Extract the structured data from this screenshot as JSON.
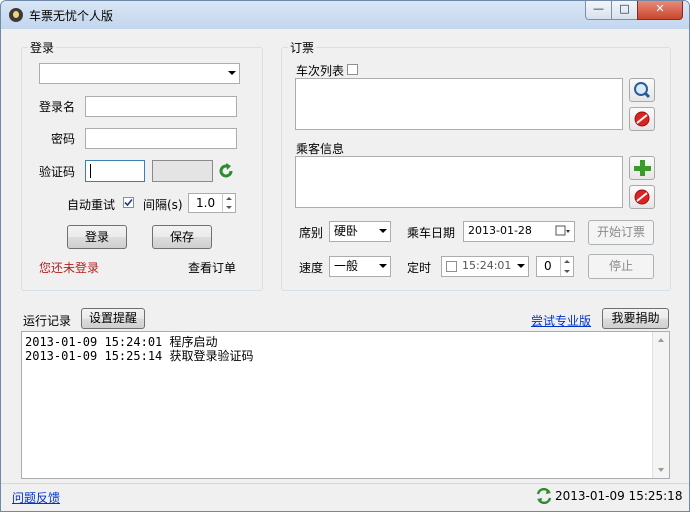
{
  "window": {
    "title": "车票无忧个人版",
    "min": "—",
    "max": "□",
    "close": "✕"
  },
  "login": {
    "group_label": "登录",
    "account_select": "",
    "username_label": "登录名",
    "username_value": "",
    "password_label": "密码",
    "password_value": "",
    "captcha_label": "验证码",
    "captcha_value": "",
    "auto_retry_label": "自动重试",
    "auto_retry_checked": true,
    "interval_label": "间隔(s)",
    "interval_value": "1.0",
    "login_button": "登录",
    "save_button": "保存",
    "status_text": "您还未登录",
    "view_orders_link": "查看订单"
  },
  "order": {
    "group_label": "订票",
    "train_list_label": "车次列表",
    "train_list_checked": false,
    "passenger_label": "乘客信息",
    "seat_label": "席别",
    "seat_value": "硬卧",
    "date_label": "乘车日期",
    "date_value": "2013-01-28",
    "start_button": "开始订票",
    "speed_label": "速度",
    "speed_value": "一般",
    "timer_label": "定时",
    "timer_checked": false,
    "timer_value": "15:24:01",
    "timer_count": "0",
    "stop_button": "停止"
  },
  "log": {
    "label": "运行记录",
    "settings_button": "设置提醒",
    "pro_link": "尝试专业版",
    "donate_button": "我要捐助",
    "lines": [
      "2013-01-09 15:24:01 程序启动",
      "2013-01-09 15:25:14 获取登录验证码"
    ]
  },
  "statusbar": {
    "feedback_link": "问题反馈",
    "datetime": "2013-01-09 15:25:18"
  },
  "colors": {
    "status_red": "#b22222",
    "link_blue": "#0033cc"
  }
}
